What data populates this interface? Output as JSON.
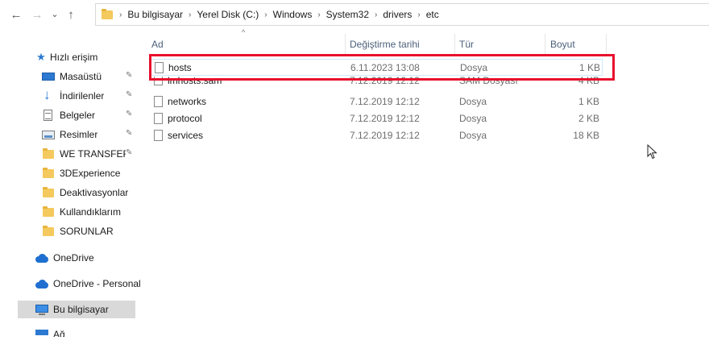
{
  "nav": {
    "back_glyph": "←",
    "forward_glyph": "→",
    "history_glyph": "⌄",
    "up_glyph": "↑"
  },
  "breadcrumb": [
    "Bu bilgisayar",
    "Yerel Disk (C:)",
    "Windows",
    "System32",
    "drivers",
    "etc"
  ],
  "sidebar": {
    "quick_access": "Hızlı erişim",
    "items": [
      {
        "label": "Masaüstü",
        "icon": "desktop-icon",
        "pinned": true
      },
      {
        "label": "İndirilenler",
        "icon": "downloads-icon",
        "pinned": true
      },
      {
        "label": "Belgeler",
        "icon": "documents-icon",
        "pinned": true
      },
      {
        "label": "Resimler",
        "icon": "pictures-icon",
        "pinned": true
      },
      {
        "label": "WE TRANSFER KU",
        "icon": "folder-icon",
        "pinned": true
      },
      {
        "label": "3DExperience",
        "icon": "folder-icon",
        "pinned": false
      },
      {
        "label": "Deaktivasyonlar",
        "icon": "folder-icon",
        "pinned": false
      },
      {
        "label": "Kullandıklarım",
        "icon": "folder-icon",
        "pinned": false
      },
      {
        "label": "SORUNLAR",
        "icon": "folder-icon",
        "pinned": false
      }
    ],
    "onedrive": "OneDrive",
    "onedrive_personal": "OneDrive - Personal",
    "this_pc": "Bu bilgisayar",
    "network": "Ağ",
    "pin_glyph": "📌"
  },
  "columns": {
    "name": "Ad",
    "date": "Değiştirme tarihi",
    "type": "Tür",
    "size": "Boyut",
    "sort_glyph": "^"
  },
  "files": [
    {
      "name": "hosts",
      "date": "6.11.2023 13:08",
      "type": "Dosya",
      "size": "1 KB"
    },
    {
      "name": "lmhosts.sam",
      "date": "7.12.2019 12:12",
      "type": "SAM Dosyası",
      "size": "4 KB"
    },
    {
      "name": "networks",
      "date": "7.12.2019 12:12",
      "type": "Dosya",
      "size": "1 KB"
    },
    {
      "name": "protocol",
      "date": "7.12.2019 12:12",
      "type": "Dosya",
      "size": "2 KB"
    },
    {
      "name": "services",
      "date": "7.12.2019 12:12",
      "type": "Dosya",
      "size": "18 KB"
    }
  ],
  "colors": {
    "highlight_border": "#e8112d",
    "selection": "#d9d9d9",
    "accent": "#2b79d1"
  }
}
